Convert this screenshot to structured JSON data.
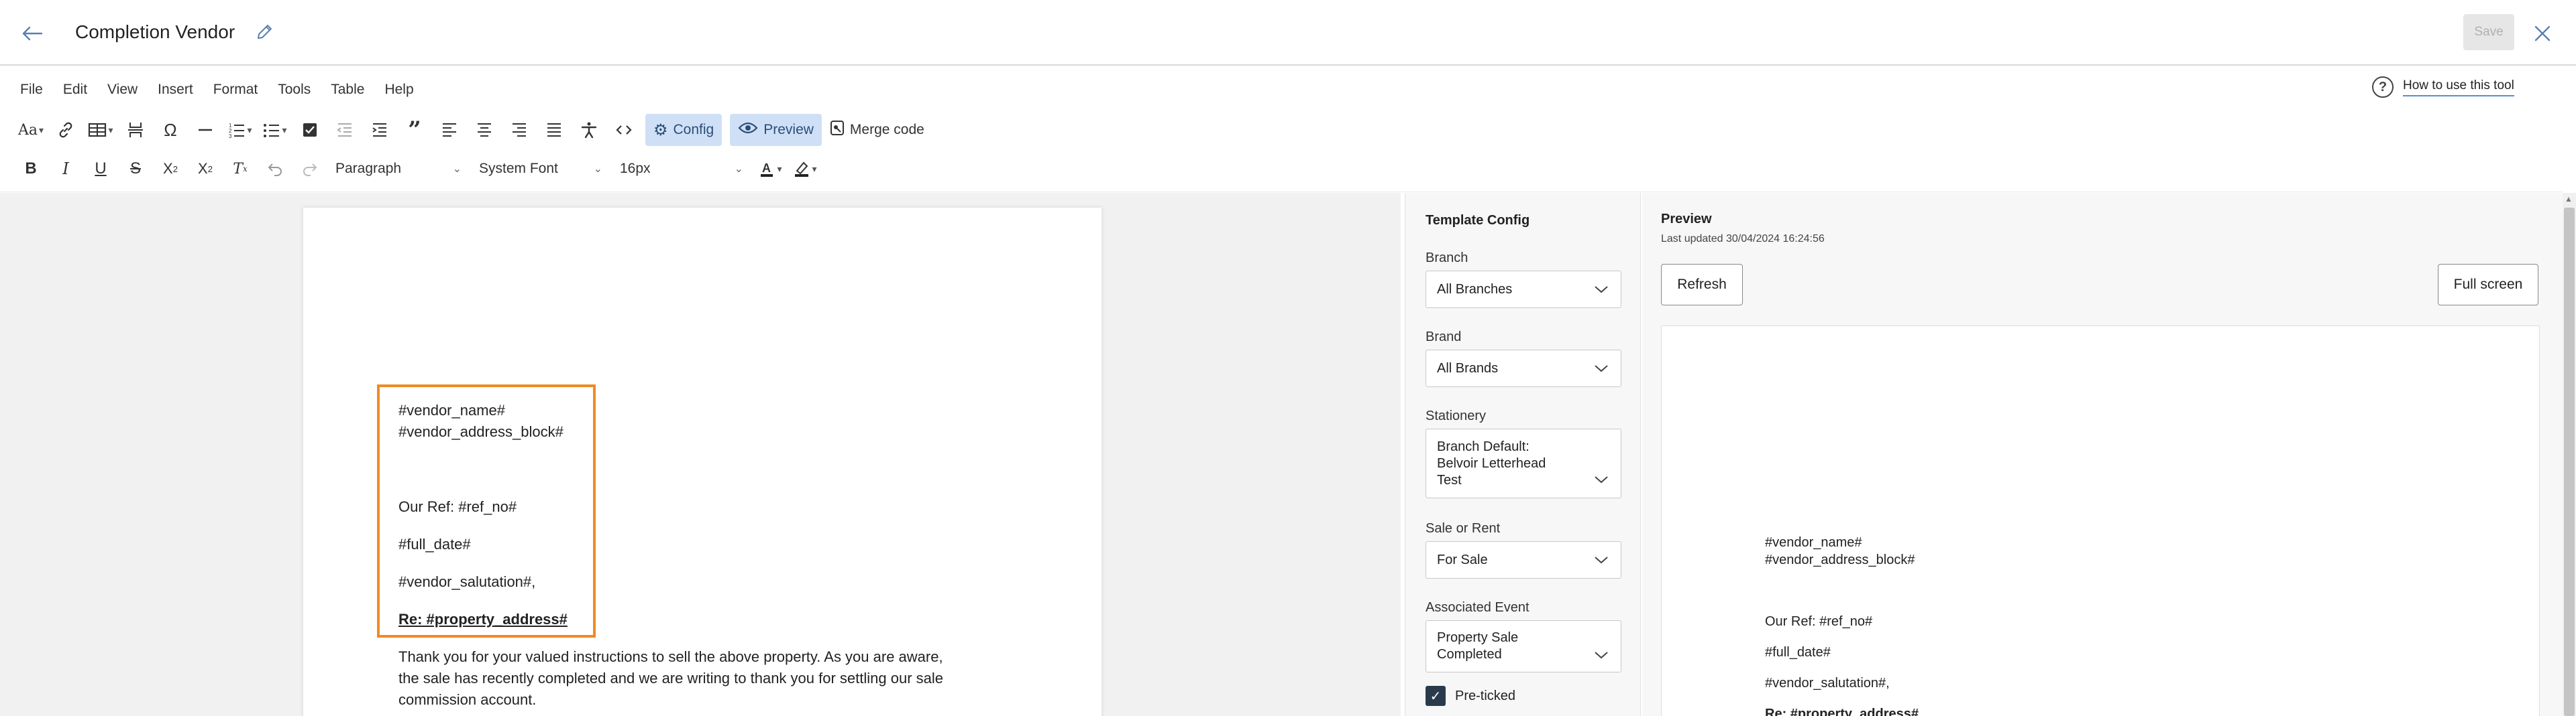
{
  "header": {
    "title": "Completion Vendor",
    "save_label": "Save"
  },
  "menu": [
    "File",
    "Edit",
    "View",
    "Insert",
    "Format",
    "Tools",
    "Table",
    "Help"
  ],
  "help": {
    "label": "How to use this tool"
  },
  "toolbar": {
    "config_label": "Config",
    "preview_label": "Preview",
    "merge_code_label": "Merge code",
    "block_format": "Paragraph",
    "font_family": "System Font",
    "font_size": "16px"
  },
  "document": {
    "vendor_name": "#vendor_name#",
    "vendor_address": "#vendor_address_block#",
    "our_ref": "Our Ref: #ref_no#",
    "full_date": "#full_date#",
    "salutation": "#vendor_salutation#,",
    "re_line": "Re: #property_address#",
    "body_line1": "Thank you for your valued instructions to sell the above property. As you are aware,",
    "body_line2": "the sale has recently completed and we are writing to thank you for settling our sale",
    "body_line3": "commission account."
  },
  "template_config": {
    "title": "Template Config",
    "branch_label": "Branch",
    "branch_value": "All Branches",
    "brand_label": "Brand",
    "brand_value": "All Brands",
    "stationery_label": "Stationery",
    "stationery_value_line1": "Branch Default:",
    "stationery_value_line2": "Belvoir Letterhead",
    "stationery_value_line3": "Test",
    "sale_rent_label": "Sale or Rent",
    "sale_rent_value": "For Sale",
    "event_label": "Associated Event",
    "event_value_line1": "Property Sale",
    "event_value_line2": "Completed",
    "preticked_label": "Pre-ticked",
    "preticked_checked": true
  },
  "preview": {
    "title": "Preview",
    "last_updated": "Last updated 30/04/2024 16:24:56",
    "refresh_label": "Refresh",
    "fullscreen_label": "Full screen",
    "vendor_name": "#vendor_name#",
    "vendor_address": "#vendor_address_block#",
    "our_ref": "Our Ref: #ref_no#",
    "full_date": "#full_date#",
    "salutation": "#vendor_salutation#,",
    "re_line": "Re: #property_address#"
  },
  "colors": {
    "accent": "#5a7fb0",
    "highlight_border": "#f08a24",
    "toolbar_active": "#cfe0f6",
    "checkbox": "#2a3a4d"
  }
}
